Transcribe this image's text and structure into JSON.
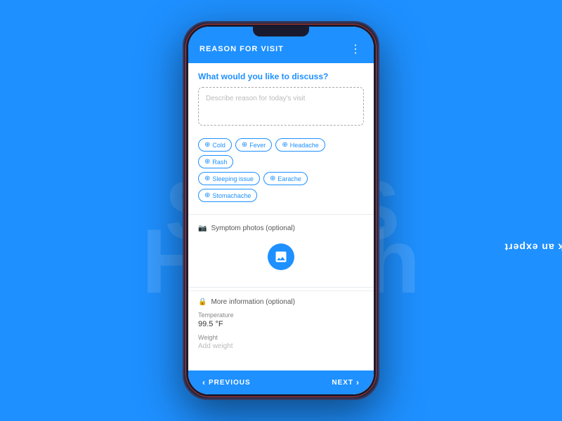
{
  "background": {
    "color": "#1e90ff",
    "samsung_text": "SAMS",
    "health_text": "Health"
  },
  "ask_expert": {
    "label": "Ask an expert"
  },
  "phone": {
    "header": {
      "title": "REASON FOR VISIT",
      "menu_dots": "⋮"
    },
    "question": "What would you like to discuss?",
    "input_placeholder": "Describe reason for today's visit",
    "tags": [
      {
        "label": "Cold"
      },
      {
        "label": "Fever"
      },
      {
        "label": "Headache"
      },
      {
        "label": "Rash"
      },
      {
        "label": "Sleeping issue"
      },
      {
        "label": "Earache"
      },
      {
        "label": "Stomachache"
      }
    ],
    "photos": {
      "label": "Symptom photos (optional)",
      "camera_icon": "🖼"
    },
    "more_info": {
      "label": "More information (optional)",
      "lock_icon": "🔒",
      "temperature_label": "Temperature",
      "temperature_value": "99.5 °F",
      "weight_label": "Weight",
      "weight_placeholder": "Add weight"
    },
    "footer": {
      "previous_label": "PREVIOUS",
      "next_label": "NEXT"
    }
  }
}
